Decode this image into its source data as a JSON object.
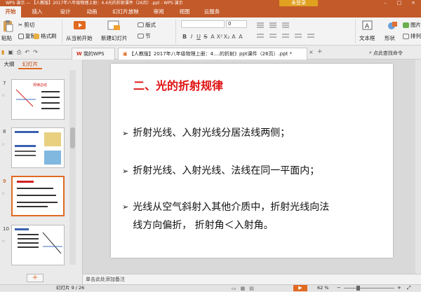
{
  "titlebar": {
    "app": "WPS 演示",
    "doc": "【人教版】2017年八年级物理上册：4.4光的折射课件（26页）.ppt - WPS 演示",
    "login": "未登录",
    "controls": [
      "–",
      "□",
      "×"
    ]
  },
  "menu": {
    "tabs": [
      "开始",
      "插入",
      "设计",
      "动画",
      "幻灯片放映",
      "审阅",
      "视图",
      "云服务"
    ]
  },
  "ribbon": {
    "paste": "粘贴",
    "cut": "剪切",
    "copy": "复制",
    "format_painter": "格式刷",
    "from_current": "从当前开始",
    "new_slide": "新建幻灯片",
    "layout": "版式",
    "section": "节",
    "textbox": "文本框",
    "shape": "形状",
    "arrange": "排列",
    "picture": "图片",
    "font_size": "0",
    "font_btns": [
      "B",
      "I",
      "U",
      "S",
      "A",
      "X²",
      "X₂",
      "A",
      "A"
    ]
  },
  "docbar": {
    "tab_mywps": "我的WPS",
    "tab_doc": "【人教版】2017年八年级物理上册：4....的折射》ppt课件（26页）.ppt *",
    "close": "×",
    "add": "+",
    "search_placeholder": "点此查找命令"
  },
  "leftpanel": {
    "tabs": [
      "大纲",
      "幻灯片"
    ],
    "slides": [
      "7",
      "8",
      "9",
      "10"
    ],
    "add": "+"
  },
  "slide": {
    "title": "二、光的折射规律",
    "bullets": [
      [
        "折射光线、入射光线分居法线两侧；"
      ],
      [
        "折射光线、入射光线、法线在同一平面内；"
      ],
      [
        "光线从空气斜射入其他介质中，折射光线向法",
        "线方向偏折，  折射角＜入射角。"
      ]
    ],
    "bullet_marker": "➢"
  },
  "notes": {
    "placeholder": "单击此处添加备注"
  },
  "status": {
    "slide_info": "幻灯片 9 / 26",
    "zoom": "62 %"
  }
}
